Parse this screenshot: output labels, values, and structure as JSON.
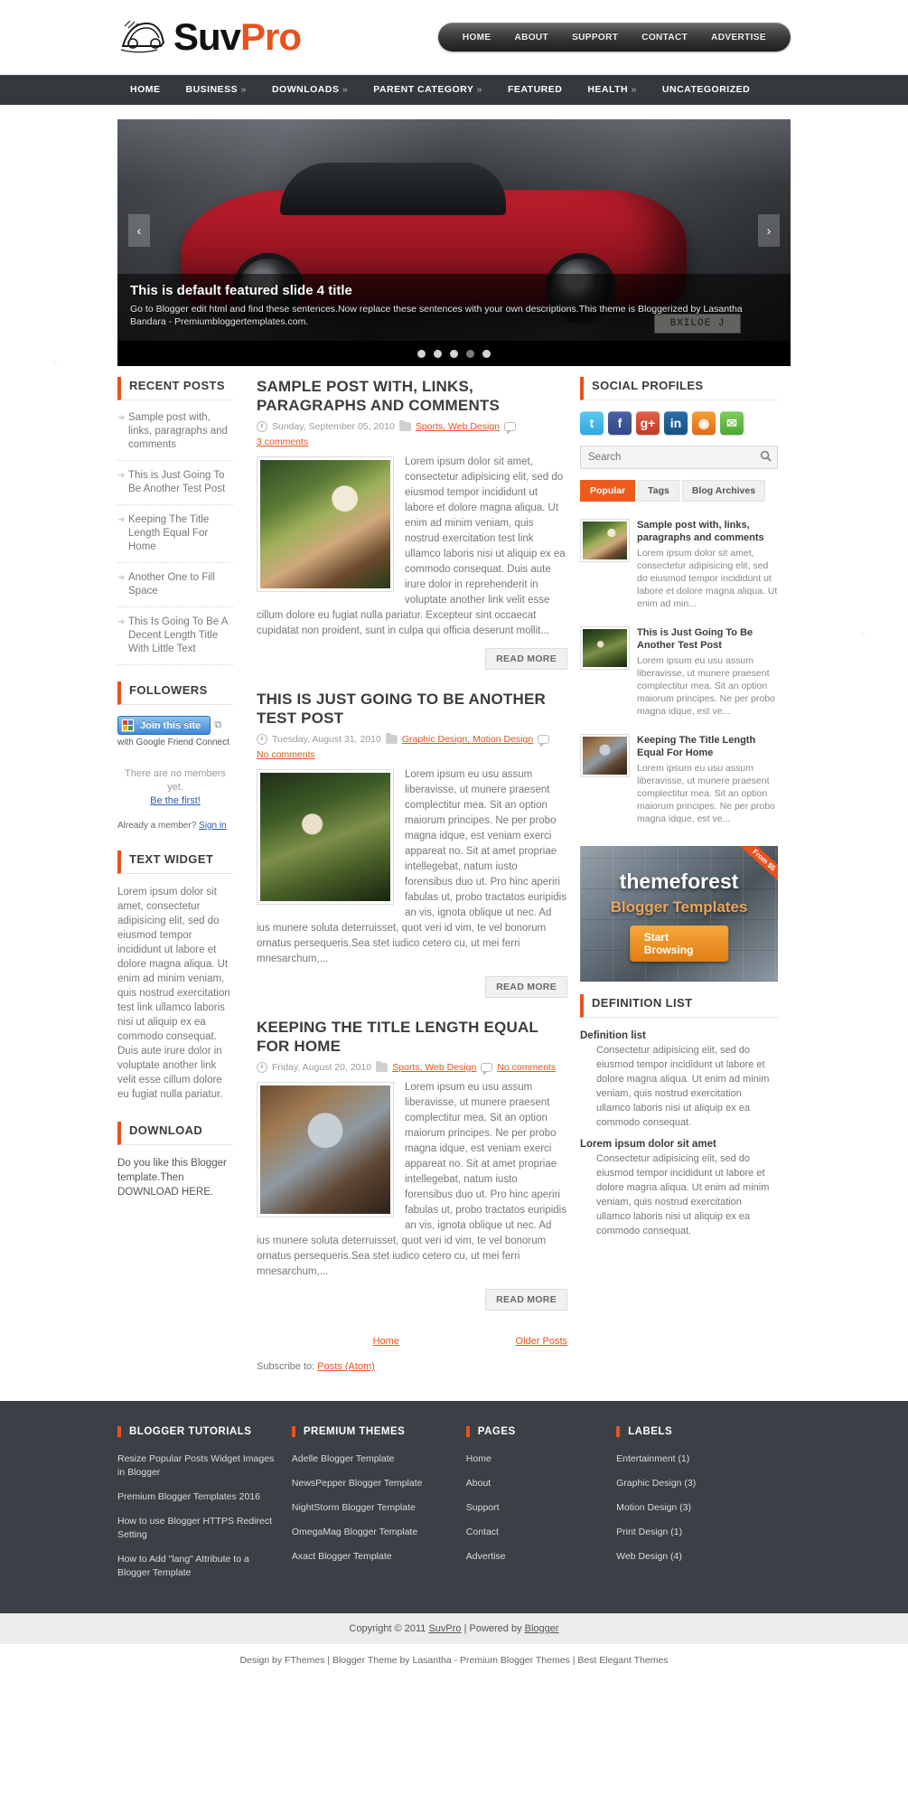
{
  "site": {
    "logo_primary": "Suv",
    "logo_secondary": "Pro"
  },
  "topnav": {
    "items": [
      {
        "label": "HOME"
      },
      {
        "label": "ABOUT"
      },
      {
        "label": "SUPPORT"
      },
      {
        "label": "CONTACT"
      },
      {
        "label": "ADVERTISE"
      }
    ]
  },
  "mainnav": {
    "items": [
      {
        "label": "HOME",
        "caret": ""
      },
      {
        "label": "BUSINESS",
        "caret": "»"
      },
      {
        "label": "DOWNLOADS",
        "caret": "»"
      },
      {
        "label": "PARENT CATEGORY",
        "caret": "»"
      },
      {
        "label": "FEATURED",
        "caret": ""
      },
      {
        "label": "HEALTH",
        "caret": "»"
      },
      {
        "label": "UNCATEGORIZED",
        "caret": ""
      }
    ]
  },
  "slider": {
    "title": "This is default featured slide 4 title",
    "description": "Go to Blogger edit html and find these sentences.Now replace these sentences with your own descriptions.This theme is Bloggerized by Lasantha Bandara - Premiumbloggertemplates.com.",
    "plate_text": "BXILOE J",
    "prev_label": "‹",
    "next_label": "›",
    "dots": 5,
    "active_dot": 4
  },
  "sidebar_left": {
    "recent_posts": {
      "title": "RECENT POSTS",
      "items": [
        {
          "label": "Sample post with, links, paragraphs and comments"
        },
        {
          "label": "This is Just Going To Be Another Test Post"
        },
        {
          "label": "Keeping The Title Length Equal For Home"
        },
        {
          "label": "Another One to Fill Space"
        },
        {
          "label": "This Is Going To Be A Decent Length Title With Little Text"
        }
      ]
    },
    "followers": {
      "title": "FOLLOWERS",
      "join_label": "Join this site",
      "sub_label": "with Google Friend Connect",
      "more_label": "⧉",
      "empty_text": "There are no members yet.",
      "be_first": "Be the first!",
      "already_member": "Already a member?",
      "signin": "Sign in"
    },
    "text_widget": {
      "title": "TEXT WIDGET",
      "body": "Lorem ipsum dolor sit amet, consectetur adipisicing elit, sed do eiusmod tempor incididunt ut labore et dolore magna aliqua. Ut enim ad minim veniam, quis nostrud exercitation test link ullamco laboris nisi ut aliquip ex ea commodo consequat. Duis aute irure dolor in voluptate another link velit esse cillum dolore eu fugiat nulla pariatur."
    },
    "download": {
      "title": "DOWNLOAD",
      "body": "Do you like this Blogger template.Then DOWNLOAD HERE."
    }
  },
  "posts": [
    {
      "title": "SAMPLE POST WITH, LINKS, PARAGRAPHS AND COMMENTS",
      "date": "Sunday, September 05, 2010",
      "labels": "Sports, Web Design",
      "comments": "3 comments",
      "body": "Lorem ipsum dolor sit amet, consectetur adipisicing elit, sed do eiusmod tempor incididunt ut labore et dolore magna aliqua. Ut enim ad minim veniam, quis nostrud exercitation test link ullamco laboris nisi ut aliquip ex ea commodo consequat. Duis aute irure dolor in reprehenderit in voluptate another link velit esse cillum dolore eu fugiat nulla pariatur. Excepteur sint occaecat cupidatat non proident, sunt in culpa qui officia deserunt mollit...",
      "readmore": "READ MORE",
      "thumb": "t1"
    },
    {
      "title": "THIS IS JUST GOING TO BE ANOTHER TEST POST",
      "date": "Tuesday, August 31, 2010",
      "labels": "Graphic Design, Motion Design",
      "comments": "No comments",
      "body": "Lorem ipsum eu usu assum liberavisse, ut munere praesent complectitur mea. Sit an option maiorum principes. Ne per probo magna idque, est veniam exerci appareat no. Sit at amet propriae intellegebat, natum iusto forensibus duo ut. Pro hinc aperiri fabulas ut, probo tractatos euripidis an vis, ignota oblique ut nec. Ad ius munere soluta deterruisset, quot veri id vim, te vel bonorum ornatus persequeris.Sea stet iudico cetero cu, ut mei ferri mnesarchum,...",
      "readmore": "READ MORE",
      "thumb": "t2"
    },
    {
      "title": "KEEPING THE TITLE LENGTH EQUAL FOR HOME",
      "date": "Friday, August 20, 2010",
      "labels": "Sports, Web Design",
      "comments": "No comments",
      "body": "Lorem ipsum eu usu assum liberavisse, ut munere praesent complectitur mea. Sit an option maiorum principes. Ne per probo magna idque, est veniam exerci appareat no. Sit at amet propriae intellegebat, natum iusto forensibus duo ut. Pro hinc aperiri fabulas ut, probo tractatos euripidis an vis, ignota oblique ut nec. Ad ius munere soluta deterruisset, quot veri id vim, te vel bonorum ornatus persequeris.Sea stet iudico cetero cu, ut mei ferri mnesarchum,...",
      "readmore": "READ MORE",
      "thumb": "t3"
    }
  ],
  "pager": {
    "home": "Home",
    "older": "Older Posts",
    "subscribe_label": "Subscribe to:",
    "subscribe_link": "Posts (Atom)"
  },
  "sidebar_right": {
    "social": {
      "title": "SOCIAL PROFILES",
      "icons": [
        {
          "name": "twitter-icon",
          "glyph": "t"
        },
        {
          "name": "facebook-icon",
          "glyph": "f"
        },
        {
          "name": "google-plus-icon",
          "glyph": "g+"
        },
        {
          "name": "linkedin-icon",
          "glyph": "in"
        },
        {
          "name": "rss-icon",
          "glyph": "◉"
        },
        {
          "name": "email-icon",
          "glyph": "✉"
        }
      ]
    },
    "search": {
      "placeholder": "Search",
      "value": "",
      "icon": "search-icon"
    },
    "tabs": [
      {
        "label": "Popular",
        "active": true
      },
      {
        "label": "Tags",
        "active": false
      },
      {
        "label": "Blog Archives",
        "active": false
      }
    ],
    "popular": [
      {
        "title": "Sample post with, links, paragraphs and comments",
        "excerpt": "Lorem ipsum dolor sit amet, consectetur adipisicing elit, sed do eiusmod tempor incididunt ut labore et dolore magna aliqua. Ut enim ad min...",
        "thumb": "t1"
      },
      {
        "title": "This is Just Going To Be Another Test Post",
        "excerpt": "Lorem ipsum eu usu assum liberavisse, ut munere praesent complectitur mea. Sit an option maiorum principes. Ne per probo magna idque, est ve...",
        "thumb": "t2"
      },
      {
        "title": "Keeping The Title Length Equal For Home",
        "excerpt": "Lorem ipsum eu usu assum liberavisse, ut munere praesent complectitur mea. Sit an option maiorum principes. Ne per probo magna idque, est ve...",
        "thumb": "t3"
      }
    ],
    "ad": {
      "ribbon": "From $5",
      "title": "themeforest",
      "subtitle": "Blogger Templates",
      "button": "Start Browsing"
    },
    "definition": {
      "title": "DEFINITION LIST",
      "items": [
        {
          "term": "Definition list",
          "desc": "Consectetur adipisicing elit, sed do eiusmod tempor incididunt ut labore et dolore magna aliqua. Ut enim ad minim veniam, quis nostrud exercitation ullamco laboris nisi ut aliquip ex ea commodo consequat."
        },
        {
          "term": "Lorem ipsum dolor sit amet",
          "desc": "Consectetur adipisicing elit, sed do eiusmod tempor incididunt ut labore et dolore magna aliqua. Ut enim ad minim veniam, quis nostrud exercitation ullamco laboris nisi ut aliquip ex ea commodo consequat."
        }
      ]
    }
  },
  "footer": {
    "columns": [
      {
        "title": "BLOGGER TUTORIALS",
        "links": [
          "Resize Popular Posts Widget Images in Blogger",
          "Premium Blogger Templates 2016",
          "How to use Blogger HTTPS Redirect Setting",
          "How to Add \"lang\" Attribute to a Blogger Template"
        ]
      },
      {
        "title": "PREMIUM THEMES",
        "links": [
          "Adelle Blogger Template",
          "NewsPepper Blogger Template",
          "NightStorm Blogger Template",
          "OmegaMag Blogger Template",
          "Axact Blogger Template"
        ]
      },
      {
        "title": "PAGES",
        "links": [
          "Home",
          "About",
          "Support",
          "Contact",
          "Advertise"
        ]
      },
      {
        "title": "LABELS",
        "links": [
          "Entertainment (1)",
          "Graphic Design (3)",
          "Motion Design (3)",
          "Print Design (1)",
          "Web Design (4)"
        ]
      }
    ],
    "copyright_pre": "Copyright © 2011",
    "copyright_site": "SuvPro",
    "copyright_mid": "| Powered by",
    "copyright_blogger": "Blogger",
    "credit": "Design by FThemes | Blogger Theme by Lasantha - Premium Blogger Themes | Best Elegant Themes"
  }
}
